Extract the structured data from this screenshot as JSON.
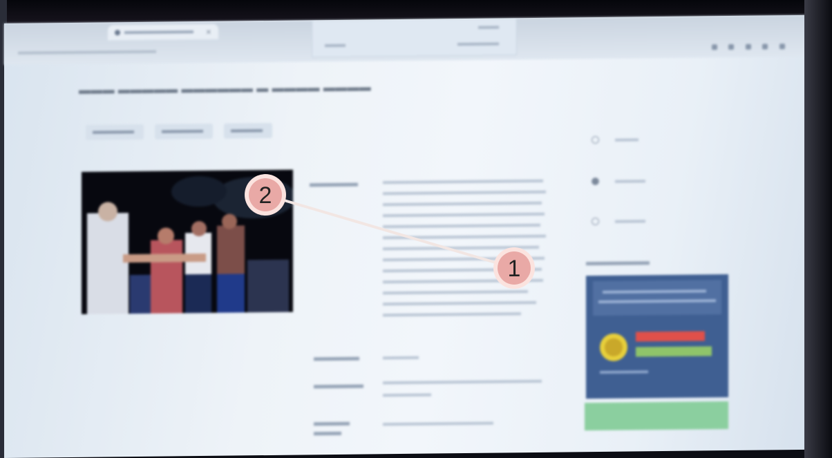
{
  "scene": {
    "description_type": "photo-of-monitor",
    "colors": {
      "screen_bg": "#eef3f8",
      "badge_fill": "#e9a9a6",
      "badge_ring": "#fbe3df",
      "line": "#f4e9e6",
      "poster_blue": "#3f5f92",
      "green_button": "#8bcf9f"
    }
  },
  "annotations": {
    "marker_1": "1",
    "marker_2": "2"
  }
}
